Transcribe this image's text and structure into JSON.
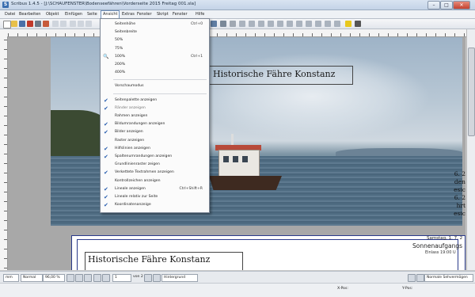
{
  "window": {
    "title": "Scribus 1.4.5 - [J:\\SCHAUFENSTER\\Bodenseefähren\\Vorderseite 2015 Freitag 001.sla]",
    "icon_letter": "S",
    "minimize": "–",
    "maximize": "□",
    "close": "✕"
  },
  "menubar": [
    "Datei",
    "Bearbeiten",
    "Objekt",
    "Einfügen",
    "Seite",
    "Ansicht",
    "Extras",
    "Fenster",
    "Skript",
    "Fenster",
    "Hilfe"
  ],
  "menu_view": {
    "items": [
      {
        "label": "Seitenhöhe",
        "shortcut": "Ctrl+0",
        "checked": false
      },
      {
        "label": "Seitenbreite",
        "shortcut": "",
        "checked": false
      },
      {
        "label": "50%",
        "shortcut": "",
        "checked": false
      },
      {
        "label": "75%",
        "shortcut": "",
        "checked": false
      },
      {
        "label": "100%",
        "shortcut": "Ctrl+1",
        "checked": false,
        "icon": "magnifier-icon"
      },
      {
        "label": "200%",
        "shortcut": "",
        "checked": false
      },
      {
        "label": "400%",
        "shortcut": "",
        "checked": false
      },
      {
        "separator": true
      },
      {
        "label": "Vorschaumodus",
        "shortcut": "",
        "checked": false
      },
      {
        "separator": true
      },
      {
        "label": "Seitenpalette anzeigen",
        "shortcut": "",
        "checked": true
      },
      {
        "label": "Ränder anzeigen",
        "shortcut": "",
        "checked": true,
        "disabled": true
      },
      {
        "label": "Rahmen anzeigen",
        "shortcut": "",
        "checked": false
      },
      {
        "label": "Bildumrandungen anzeigen",
        "shortcut": "",
        "checked": true
      },
      {
        "label": "Bilder anzeigen",
        "shortcut": "",
        "checked": true
      },
      {
        "label": "Raster anzeigen",
        "shortcut": "",
        "checked": false
      },
      {
        "label": "Hilfslinien anzeigen",
        "shortcut": "",
        "checked": true
      },
      {
        "label": "Spaltenumrandungen anzeigen",
        "shortcut": "",
        "checked": true
      },
      {
        "label": "Grundlinienraster zeigen",
        "shortcut": "",
        "checked": false
      },
      {
        "label": "Verkettete Textrahmen anzeigen",
        "shortcut": "",
        "checked": true
      },
      {
        "label": "Kontrollzeichen anzeigen",
        "shortcut": "",
        "checked": false
      },
      {
        "label": "Lineale anzeigen",
        "shortcut": "Ctrl+Shift+R",
        "checked": true
      },
      {
        "label": "Lineale relativ zur Seite",
        "shortcut": "",
        "checked": true
      },
      {
        "label": "Koordinatenanzeige",
        "shortcut": "",
        "checked": true
      }
    ]
  },
  "document": {
    "title1": "Historische Fähre Konstanz",
    "title2": "Historische Fähre Konstanz",
    "right_snippets": [
      "6. 2",
      "den",
      "esic",
      "6. 2",
      "hrt",
      "esic"
    ],
    "p2_day": "Samstag, 1. 7. 2",
    "p2_sunrise": "Sonnenaufgangs",
    "p2_entry": "Einlass 19:00 U"
  },
  "statusbar": {
    "unit": "mm",
    "mode": "Normal",
    "zoom": "96,00 %",
    "page": "1",
    "page_of": "von 2",
    "layer": "Hintergrund",
    "view_mode": "Normale Sehvermögen"
  },
  "bottombar": {
    "x_label": "X-Pos:",
    "y_label": "Y-Pos:"
  },
  "colors": {
    "accent": "#2a5fb0",
    "page_border": "#2a3a8a"
  }
}
